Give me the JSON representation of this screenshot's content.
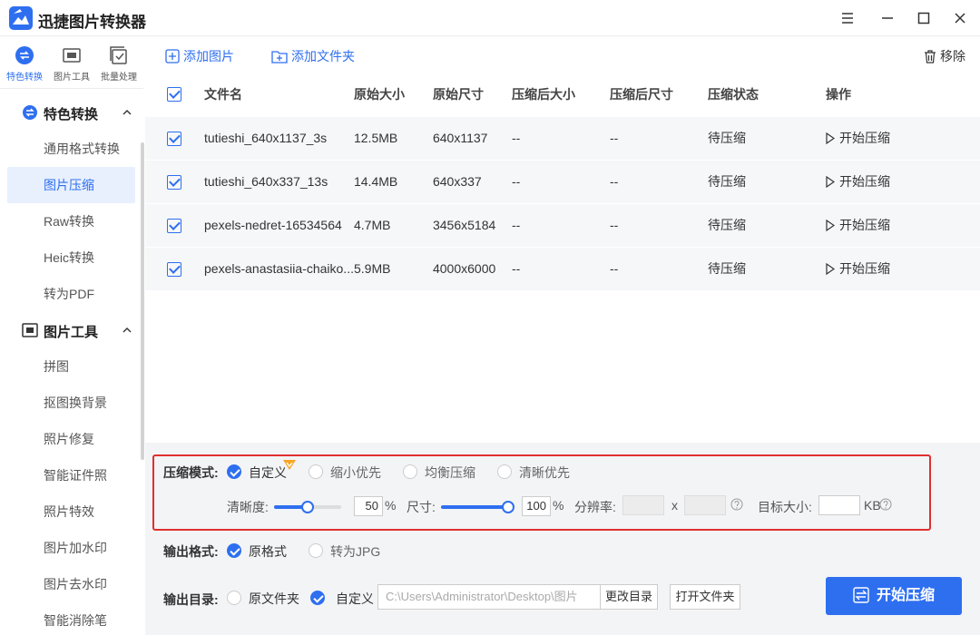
{
  "app": {
    "title": "迅捷图片转换器"
  },
  "colors": {
    "accent": "#2e6ff0",
    "highlight_border": "#e02f2f",
    "active_bg": "#e8f0fe"
  },
  "rail": [
    {
      "label": "特色转换",
      "icon": "convert-icon",
      "active": true
    },
    {
      "label": "图片工具",
      "icon": "image-tool-icon",
      "active": false
    },
    {
      "label": "批量处理",
      "icon": "batch-icon",
      "active": false
    }
  ],
  "sidebar": {
    "groups": [
      {
        "label": "特色转换",
        "icon": "convert-icon",
        "items": [
          "通用格式转换",
          "图片压缩",
          "Raw转换",
          "Heic转换",
          "转为PDF"
        ]
      },
      {
        "label": "图片工具",
        "icon": "image-tool-icon",
        "items": [
          "拼图",
          "抠图换背景",
          "照片修复",
          "智能证件照",
          "照片特效",
          "图片加水印",
          "图片去水印",
          "智能消除笔"
        ]
      }
    ],
    "active_item": "图片压缩"
  },
  "toolbar": {
    "add_image": "添加图片",
    "add_folder": "添加文件夹",
    "remove": "移除"
  },
  "table": {
    "headers": [
      "文件名",
      "原始大小",
      "原始尺寸",
      "压缩后大小",
      "压缩后尺寸",
      "压缩状态",
      "操作"
    ],
    "rows": [
      {
        "name": "tutieshi_640x1137_3s",
        "orig_size": "12.5MB",
        "orig_dim": "640x1137",
        "comp_size": "--",
        "comp_dim": "--",
        "status": "待压缩",
        "action": "开始压缩"
      },
      {
        "name": "tutieshi_640x337_13s",
        "orig_size": "14.4MB",
        "orig_dim": "640x337",
        "comp_size": "--",
        "comp_dim": "--",
        "status": "待压缩",
        "action": "开始压缩"
      },
      {
        "name": "pexels-nedret-16534564",
        "orig_size": "4.7MB",
        "orig_dim": "3456x5184",
        "comp_size": "--",
        "comp_dim": "--",
        "status": "待压缩",
        "action": "开始压缩"
      },
      {
        "name": "pexels-anastasiia-chaiko...",
        "orig_size": "5.9MB",
        "orig_dim": "4000x6000",
        "comp_size": "--",
        "comp_dim": "--",
        "status": "待压缩",
        "action": "开始压缩"
      }
    ]
  },
  "compress": {
    "mode_label": "压缩模式:",
    "modes": [
      {
        "label": "自定义",
        "selected": true
      },
      {
        "label": "缩小优先",
        "selected": false
      },
      {
        "label": "均衡压缩",
        "selected": false
      },
      {
        "label": "清晰优先",
        "selected": false
      }
    ],
    "clarity_label": "清晰度:",
    "clarity_value": "50",
    "clarity_fraction": 0.5,
    "percent": "%",
    "size_label": "尺寸:",
    "size_value": "100",
    "size_fraction": 1.0,
    "resolution_label": "分辨率:",
    "x_sep": "x",
    "target_label": "目标大小:",
    "target_unit": "KB"
  },
  "output_format": {
    "label": "输出格式:",
    "options": [
      {
        "label": "原格式",
        "selected": true
      },
      {
        "label": "转为JPG",
        "selected": false
      }
    ]
  },
  "output_dir": {
    "label": "输出目录:",
    "options": [
      {
        "label": "原文件夹",
        "selected": false
      },
      {
        "label": "自定义",
        "selected": true
      }
    ],
    "path": "C:\\Users\\Administrator\\Desktop\\图片",
    "change_btn": "更改目录",
    "open_btn": "打开文件夹"
  },
  "start_button": "开始压缩"
}
